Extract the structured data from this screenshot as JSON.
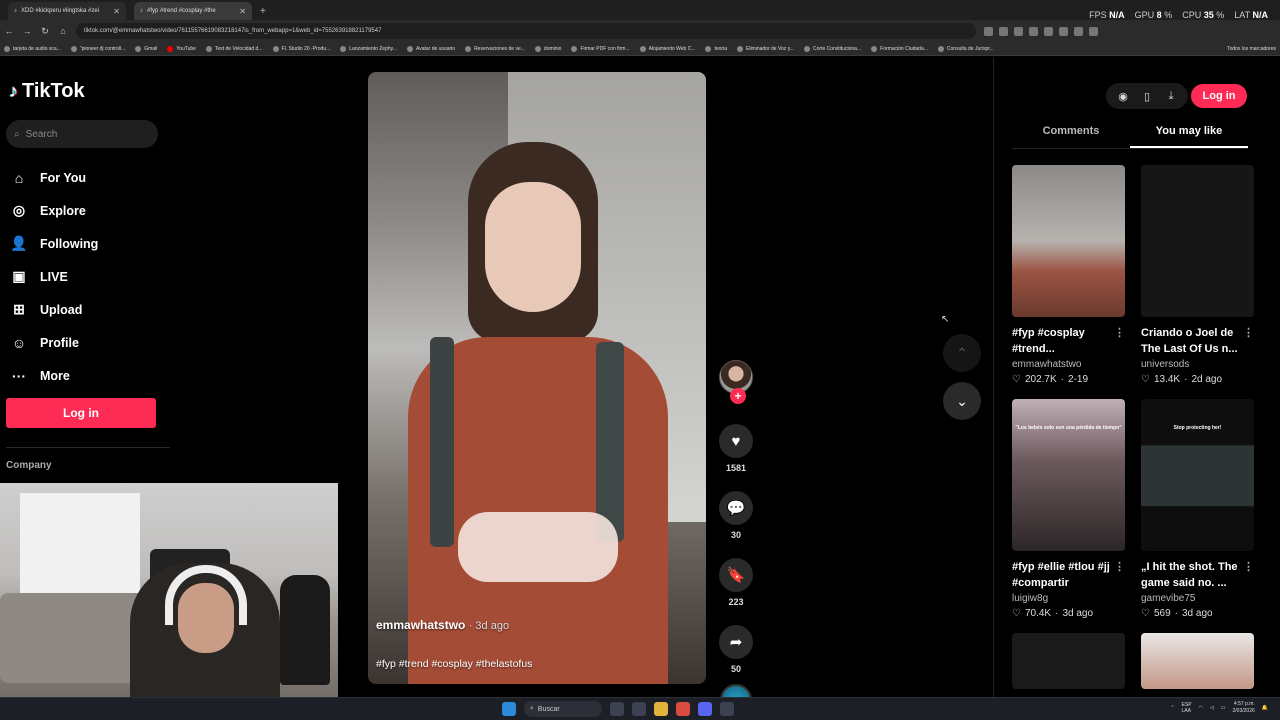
{
  "browser": {
    "tabs": [
      {
        "label": "XDD #kickperu #lingtska #zei",
        "active": false
      },
      {
        "label": "#fyp #trend #cosplay #the",
        "active": true
      }
    ],
    "url": "tiktok.com/@emmawhatstwo/video/76115576619083218147is_from_webapp=1&web_id=755263918821179547",
    "perf": {
      "fps_label": "FPS",
      "fps": "N/A",
      "gpu_label": "GPU",
      "gpu": "8",
      "gpu_unit": "%",
      "cpu_label": "CPU",
      "cpu": "35",
      "cpu_unit": "%",
      "lat_label": "LAT",
      "lat": "N/A"
    },
    "bookmarks": [
      "tarjeta de audio sca...",
      "\"pioneer dj controll...",
      "Gmail",
      "YouTube",
      "Test de Velocidad d...",
      "FL Studio 20 -Produ...",
      "Lanzamiento Zephy...",
      "Avatar de usuario",
      "Reservaciones de ve...",
      "dominio",
      "Firmar PDF con firm...",
      "Alojamiento Web C...",
      "teoria",
      "Eliminador de Voz y...",
      "Corte Constituciona...",
      "Formación Ciudada...",
      "Consulta de Jurispr..."
    ],
    "bookmarks_all": "Todos los marcadores"
  },
  "sidebar": {
    "logo": "TikTok",
    "search_placeholder": "Search",
    "nav": [
      {
        "label": "For You",
        "icon": "home-icon"
      },
      {
        "label": "Explore",
        "icon": "compass-icon"
      },
      {
        "label": "Following",
        "icon": "following-icon"
      },
      {
        "label": "LIVE",
        "icon": "live-icon"
      },
      {
        "label": "Upload",
        "icon": "upload-icon"
      },
      {
        "label": "Profile",
        "icon": "profile-icon"
      },
      {
        "label": "More",
        "icon": "more-icon"
      }
    ],
    "login": "Log in",
    "company": "Company"
  },
  "video": {
    "author": "emmawhatstwo",
    "date": "· 3d ago",
    "hashtags": "#fyp #trend #cosplay #thelastofus",
    "likes": "1581",
    "comments": "30",
    "saves": "223",
    "shares": "50"
  },
  "panel": {
    "login": "Log in",
    "tabs": [
      "Comments",
      "You may like"
    ],
    "cards": [
      {
        "title": "#fyp #cosplay #trend...",
        "author": "emmawhatstwo",
        "likes": "202.7K",
        "date": "2-19",
        "thumb_text": ""
      },
      {
        "title": "Criando o Joel de The Last Of Us n...",
        "author": "universods",
        "likes": "13.4K",
        "date": "2d ago",
        "thumb_text": ""
      },
      {
        "title": "#fyp #ellie #tlou #jj #compartir",
        "author": "luigiw8g",
        "likes": "70.4K",
        "date": "3d ago",
        "thumb_text": "\"Los bebés solo son una pérdida de tiempo\""
      },
      {
        "title": "„I hit the shot. The game said no. ...",
        "author": "gamevibe75",
        "likes": "569",
        "date": "3d ago",
        "thumb_text": "Stop protecting her!"
      }
    ]
  },
  "taskbar": {
    "search": "Buscar",
    "lang": "ESP\nLAA",
    "time": "4:57 p.m.",
    "date": "2/03/2026"
  }
}
